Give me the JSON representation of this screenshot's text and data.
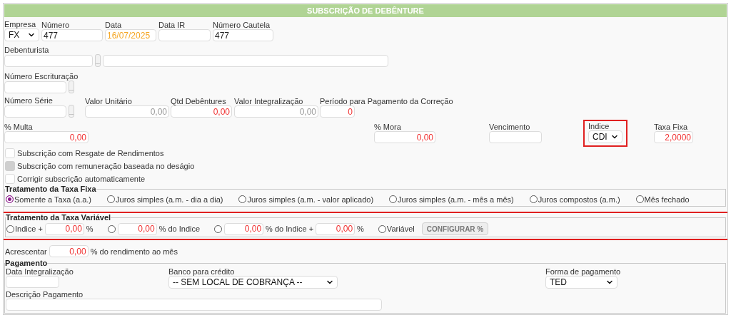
{
  "title": "SUBSCRIÇÃO DE DEBÊNTURE",
  "rows": [
    [
      {
        "kind": "select",
        "label": "Empresa",
        "value": "FX",
        "highlighted": false
      },
      {
        "kind": "text",
        "label": "Número",
        "value": "477",
        "highlighted": false
      },
      {
        "kind": "date",
        "label": "Data",
        "value": "16/07/2025",
        "highlighted": false
      },
      {
        "kind": "date",
        "label": "Data IR",
        "highlighted": false
      },
      {
        "kind": "text",
        "label": "Número Cautela",
        "value": "477",
        "highlighted": false
      }
    ],
    [
      {
        "kind": "lookup-name",
        "label": "Debenturista",
        "button": "...",
        "highlighted": false
      }
    ],
    [
      {
        "kind": "lookup",
        "label": "Número Escrituração",
        "button": "...",
        "highlighted": false
      }
    ],
    [
      {
        "kind": "lookup",
        "label": "Número Série",
        "button": "...",
        "highlighted": false
      },
      {
        "kind": "number",
        "label": "Valor Unitário",
        "placeholder": "0,00",
        "highlighted": false
      },
      {
        "kind": "number",
        "label": "Qtd Debêntures",
        "value": "0,00",
        "highlighted": false
      },
      {
        "kind": "number",
        "label": "Valor Integralização",
        "placeholder": "0,00",
        "highlighted": false
      },
      {
        "kind": "number",
        "label": "Período para Pagamento da Correção",
        "value": "0",
        "highlighted": false
      }
    ],
    [
      {
        "kind": "number",
        "label": "% Multa",
        "value": "0,00",
        "highlighted": false
      },
      {
        "kind": "number",
        "label": "% Mora",
        "value": "0,00",
        "highlighted": false
      },
      {
        "kind": "date",
        "label": "Vencimento",
        "highlighted": false
      },
      {
        "kind": "select",
        "label": "Indice",
        "value": "CDI",
        "highlighted": true
      },
      {
        "kind": "number",
        "label": "Taxa Fixa",
        "value": "2,0000",
        "highlighted": false
      }
    ]
  ],
  "checkboxes": [
    {
      "label": "Subscrição com Resgate de Rendimentos",
      "checked": false,
      "disabled": false
    },
    {
      "label": "Subscrição com remuneração baseada no deságio",
      "checked": false,
      "disabled": true
    },
    {
      "label": "Corrigir subscrição automaticamente",
      "checked": false,
      "disabled": false
    }
  ],
  "fixed_rate": {
    "legend": "Tratamento da Taxa Fixa",
    "options": [
      {
        "label": "Somente a Taxa (a.a.)",
        "selected": true
      },
      {
        "label": "Juros simples (a.m. - dia a dia)",
        "selected": false
      },
      {
        "label": "Juros simples (a.m. - valor aplicado)",
        "selected": false
      },
      {
        "label": "Juros simples (a.m. - mês a mês)",
        "selected": false
      },
      {
        "label": "Juros compostos (a.m.)",
        "selected": false
      },
      {
        "label": "Mês fechado",
        "selected": false
      }
    ]
  },
  "variable_rate": {
    "legend": "Tratamento da Taxa Variável",
    "highlighted": true,
    "parts": [
      {
        "kind": "radio",
        "label": "Indice +",
        "selected": false
      },
      {
        "kind": "input",
        "value": "0,00"
      },
      {
        "kind": "text",
        "text": "%"
      },
      {
        "kind": "radio",
        "selected": false
      },
      {
        "kind": "input",
        "value": "0,00"
      },
      {
        "kind": "text",
        "text": "% do Indice"
      },
      {
        "kind": "radio",
        "selected": false
      },
      {
        "kind": "input",
        "value": "0,00"
      },
      {
        "kind": "text",
        "text": "% do Indice +"
      },
      {
        "kind": "input",
        "value": "0,00"
      },
      {
        "kind": "text",
        "text": "%"
      },
      {
        "kind": "radio",
        "label": "Variável",
        "selected": false
      },
      {
        "kind": "button",
        "label": "CONFIGURAR %"
      }
    ]
  },
  "addition": {
    "label": "Acrescentar",
    "value": "0,00",
    "suffix": "% do rendimento ao mês"
  },
  "payment": {
    "legend": "Pagamento",
    "fields": [
      {
        "kind": "date",
        "label": "Data Integralização"
      },
      {
        "kind": "select",
        "label": "Banco para crédito",
        "value": "-- SEM LOCAL DE COBRANÇA --"
      },
      {
        "kind": "select",
        "label": "Forma de pagamento",
        "value": "TED"
      },
      {
        "kind": "text",
        "label": "Descrição Pagamento"
      }
    ]
  }
}
